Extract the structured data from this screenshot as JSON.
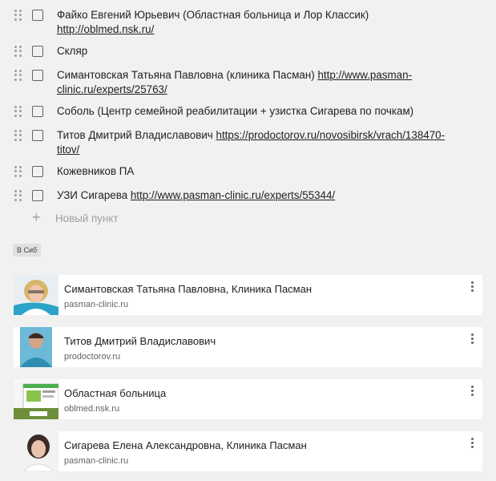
{
  "checklist": {
    "items": [
      {
        "text": "Файко  Евгений Юрьевич (Областная больница и Лор Классик) ",
        "link": "http://oblmed.nsk.ru/"
      },
      {
        "text": "Скляр",
        "link": ""
      },
      {
        "text": "Симантовская Татьяна Павловна (клиника Пасман) ",
        "link": "http://www.pasman-clinic.ru/experts/25763/"
      },
      {
        "text": "Соболь (Центр семейной реабилитации + узистка Сигарева по почкам)",
        "link": ""
      },
      {
        "text": "Титов Дмитрий Владиславович ",
        "link": "https://prodoctorov.ru/novosibirsk/vrach/138470-titov/"
      },
      {
        "text": "Кожевников ПА",
        "link": ""
      },
      {
        "text": "УЗИ Сигарева ",
        "link": "http://www.pasman-clinic.ru/experts/55344/"
      }
    ],
    "new_item_placeholder": "Новый пункт",
    "plus_glyph": "+"
  },
  "label": "В Сиб",
  "link_cards": [
    {
      "title": "Симантовская Татьяна Павловна, Клиника Пасман",
      "domain": "pasman-clinic.ru",
      "thumb": "portrait-woman-blonde"
    },
    {
      "title": "Титов Дмитрий Владиславович",
      "domain": "prodoctorov.ru",
      "thumb": "portrait-man"
    },
    {
      "title": "Областная больница",
      "domain": "oblmed.nsk.ru",
      "thumb": "website-screenshot"
    },
    {
      "title": "Сигарева Елена Александровна, Клиника Пасман",
      "domain": "pasman-clinic.ru",
      "thumb": "portrait-woman-dark"
    }
  ],
  "colors": {
    "background": "#f1f1f1",
    "card": "#ffffff",
    "muted": "#5f6368"
  }
}
